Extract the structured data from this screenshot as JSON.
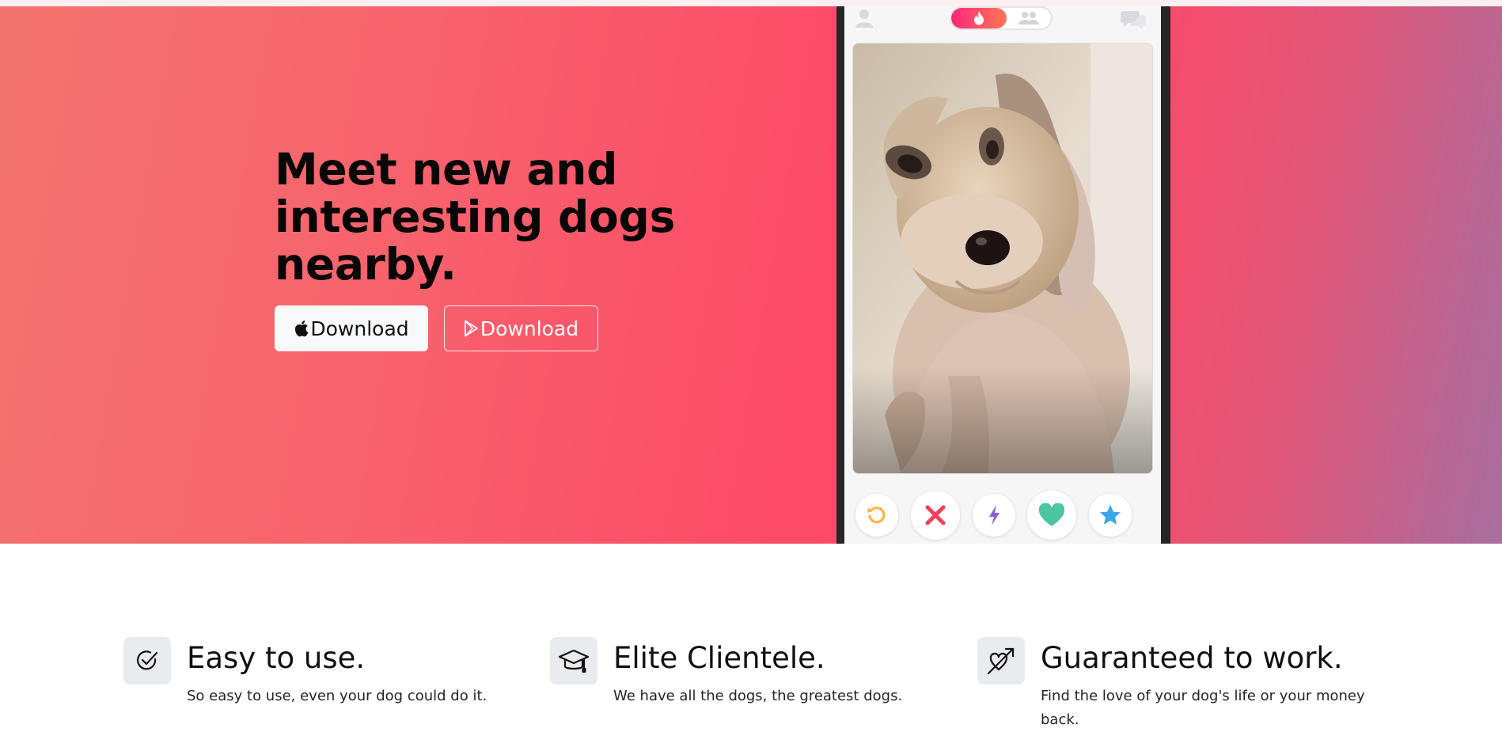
{
  "hero": {
    "title": "Meet new and interesting dogs nearby.",
    "apple_button_label": "Download",
    "play_button_label": "Download",
    "gradient_colors": [
      "#f3746f",
      "#ff4866",
      "#a76e9f"
    ]
  },
  "phone": {
    "top_icons": [
      "profile-icon",
      "flame-icon",
      "group-icon",
      "chat-bubbles-icon"
    ],
    "action_icons": [
      "rewind-icon",
      "nope-icon",
      "boost-icon",
      "like-icon",
      "super-like-icon"
    ],
    "photo_description": "dog-photo"
  },
  "features": [
    {
      "icon": "check-circle-icon",
      "title": "Easy to use.",
      "text": "So easy to use, even your dog could do it."
    },
    {
      "icon": "graduation-cap-icon",
      "title": "Elite Clientele.",
      "text": "We have all the dogs, the greatest dogs."
    },
    {
      "icon": "arrow-heart-icon",
      "title": "Guaranteed to work.",
      "text": "Find the love of your dog's life or your money back."
    }
  ],
  "colors": {
    "brand_pink": "#fd4a67",
    "nope_red": "#f0405a",
    "rewind_yellow": "#f5b748",
    "boost_purple": "#915dd1",
    "like_green": "#4bc6a0",
    "superlike_blue": "#3ca4e8"
  }
}
